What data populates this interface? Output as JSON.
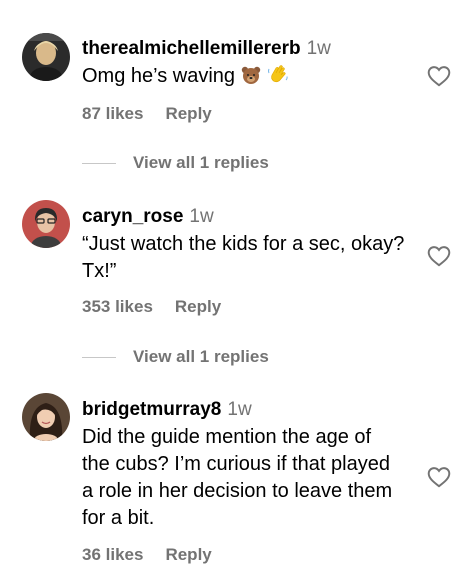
{
  "comments": [
    {
      "username": "therealmichellemillererb",
      "time": "1w",
      "text": "Omg he’s waving",
      "emoji_icons": [
        "bear-face-icon",
        "waving-hand-icon"
      ],
      "likes": "87 likes",
      "reply": "Reply",
      "view_replies": "View all 1 replies"
    },
    {
      "username": "caryn_rose",
      "time": "1w",
      "text_lines": [
        "“Just watch the kids for a sec, okay?",
        "Tx!”"
      ],
      "likes": "353 likes",
      "reply": "Reply",
      "view_replies": "View all 1 replies"
    },
    {
      "username": "bridgetmurray8",
      "time": "1w",
      "text_lines": [
        "Did the guide mention the age of",
        "the cubs? I’m curious if that played",
        "a role in her decision to leave them",
        "for a bit."
      ],
      "likes": "36 likes",
      "reply": "Reply"
    }
  ],
  "colors": {
    "secondary_text": "#737373",
    "divider": "#c7c7c7"
  }
}
